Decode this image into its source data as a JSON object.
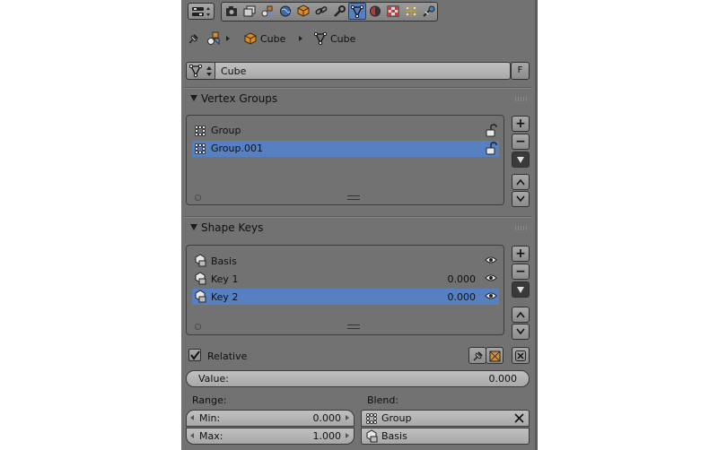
{
  "breadcrumb": {
    "object_name": "Cube",
    "mesh_name": "Cube"
  },
  "datablock": {
    "name": "Cube",
    "fake_user_label": "F"
  },
  "vertex_groups": {
    "title": "Vertex Groups",
    "items": [
      {
        "label": "Group",
        "selected": false
      },
      {
        "label": "Group.001",
        "selected": true
      }
    ]
  },
  "shape_keys": {
    "title": "Shape Keys",
    "items": [
      {
        "label": "Basis",
        "value": "",
        "selected": false
      },
      {
        "label": "Key 1",
        "value": "0.000",
        "selected": false
      },
      {
        "label": "Key 2",
        "value": "0.000",
        "selected": true
      }
    ],
    "relative_label": "Relative",
    "relative_checked": true,
    "value_label": "Value:",
    "value_value": "0.000",
    "range_label": "Range:",
    "min_label": "Min:",
    "min_value": "0.000",
    "max_label": "Max:",
    "max_value": "1.000",
    "blend_label": "Blend:",
    "blend_group": "Group",
    "blend_basis": "Basis"
  },
  "colors": {
    "panel": "#727272",
    "selection": "#5680c2",
    "active_tab": "#5680c2"
  }
}
